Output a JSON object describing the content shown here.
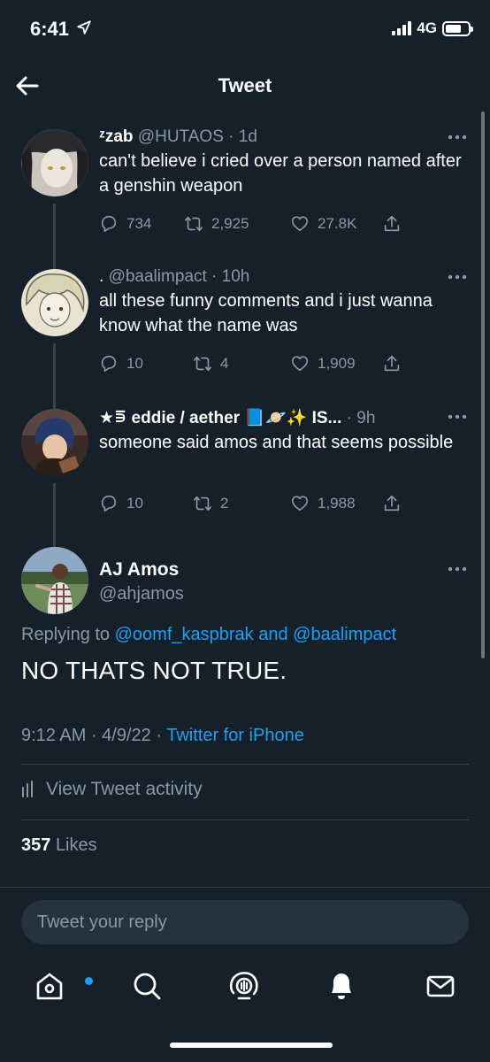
{
  "status": {
    "time": "6:41",
    "network": "4G"
  },
  "header": {
    "title": "Tweet"
  },
  "thread": [
    {
      "name": "ᶻzab",
      "handle": "@HUTAOS",
      "time": "1d",
      "text": "can't believe i cried over a person named after a genshin weapon",
      "replies": "734",
      "retweets": "2,925",
      "likes": "27.8K"
    },
    {
      "name": ".",
      "handle": "@baalimpact",
      "time": "10h",
      "text": "all these funny comments and i just wanna know what the name was",
      "replies": "10",
      "retweets": "4",
      "likes": "1,909"
    },
    {
      "name": "★⋾ eddie / aether 📘🪐✨ IS...",
      "handle": "",
      "time": "9h",
      "text": "someone said amos and that seems possible",
      "replies": "10",
      "retweets": "2",
      "likes": "1,988"
    }
  ],
  "main": {
    "name": "AJ Amos",
    "handle": "@ahjamos",
    "replying_prefix": "Replying to",
    "replying_to_1": "@oomf_kaspbrak",
    "replying_and": "and",
    "replying_to_2": "@baalimpact",
    "text": "NO THATS NOT TRUE.",
    "time": "9:12 AM",
    "date": "4/9/22",
    "source": "Twitter for iPhone",
    "activity_label": "View Tweet activity",
    "likes_count": "357",
    "likes_label": "Likes"
  },
  "reply": {
    "placeholder": "Tweet your reply"
  },
  "tabs": [
    "home-icon",
    "search-icon",
    "spaces-icon",
    "notifications-icon",
    "messages-icon"
  ],
  "colors": {
    "background": "#15202b",
    "accent": "#1da1f2",
    "muted": "#8899a6",
    "divider": "#38444d"
  }
}
